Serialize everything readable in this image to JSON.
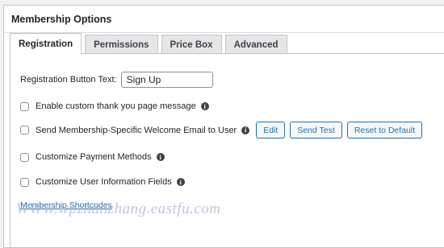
{
  "panel": {
    "title": "Membership Options"
  },
  "tabs": [
    {
      "label": "Registration"
    },
    {
      "label": "Permissions"
    },
    {
      "label": "Price Box"
    },
    {
      "label": "Advanced"
    }
  ],
  "registration_button": {
    "label": "Registration Button Text:",
    "value": "Sign Up"
  },
  "options": [
    {
      "label": "Enable custom thank you page message"
    },
    {
      "label": "Send Membership-Specific Welcome Email to User"
    },
    {
      "label": "Customize Payment Methods"
    },
    {
      "label": "Customize User Information Fields"
    }
  ],
  "email_buttons": {
    "edit": "Edit",
    "send_test": "Send Test",
    "reset": "Reset to Default"
  },
  "shortcodes_link": "Membership Shortcodes",
  "watermark": "WWW.wpzhanzhang.eastfu.com",
  "colors": {
    "accent": "#2271b1",
    "border": "#c3c4c7",
    "background": "#f1f1f1"
  }
}
